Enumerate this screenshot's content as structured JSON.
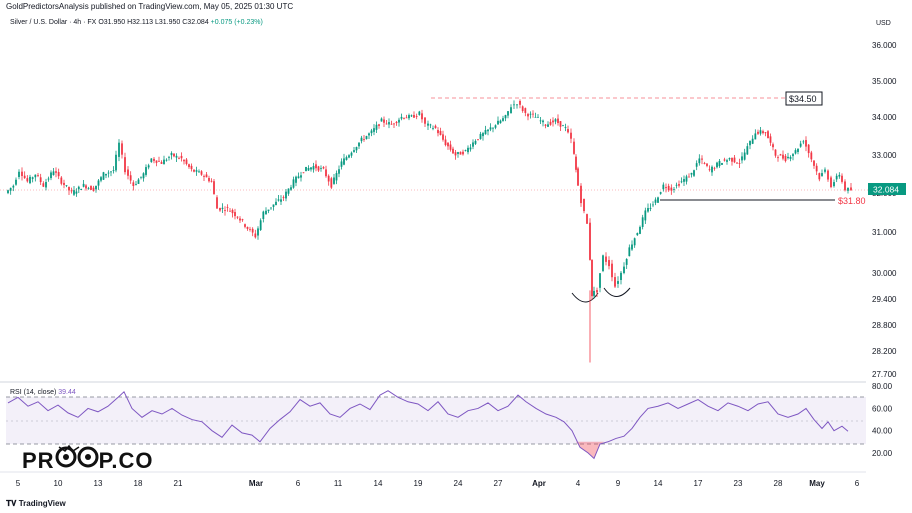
{
  "header": {
    "publisher_line": "GoldPredictorsAnalysis published on TradingView.com, May 05, 2025 01:30 UTC",
    "symbol": "Silver / U.S. Dollar · 4h · FX",
    "ohlc": "O31.950  H32.113  L31.950  C32.084",
    "change": "+0.075 (+0.23%)",
    "currency": "USD"
  },
  "rsi_label": {
    "name": "RSI (14, close)",
    "value": "39.44"
  },
  "footer": {
    "brand": "TradingView"
  },
  "logo": {
    "left": "PR",
    "right": "P.CO"
  },
  "colors": {
    "up": "#089981",
    "down": "#f23645",
    "rsi": "#7e57c2",
    "price_badge": "#089981",
    "resistance": "#f23645"
  },
  "chart_data": [
    {
      "type": "candlestick",
      "title": "Silver / U.S. Dollar · 4h · FX",
      "y_unit": "USD",
      "y_ticks": [
        "36.000",
        "35.000",
        "34.000",
        "33.000",
        "32.000",
        "31.000",
        "30.000",
        "29.400",
        "28.800",
        "28.200",
        "27.700"
      ],
      "x_ticks": [
        "5",
        "10",
        "13",
        "18",
        "21",
        "Mar",
        "6",
        "11",
        "14",
        "19",
        "24",
        "27",
        "Apr",
        "4",
        "9",
        "14",
        "17",
        "23",
        "28",
        "May",
        "6"
      ],
      "last_price": "32.084",
      "annotations": [
        {
          "type": "resistance",
          "label": "$34.50",
          "value": 34.5
        },
        {
          "type": "support",
          "label": "$31.80",
          "value": 31.8
        },
        {
          "type": "shape",
          "label": "double-bottom",
          "value": 29.4
        }
      ],
      "path": [
        [
          0,
          32.0
        ],
        [
          8,
          32.2
        ],
        [
          14,
          32.6
        ],
        [
          22,
          32.3
        ],
        [
          30,
          32.5
        ],
        [
          38,
          32.2
        ],
        [
          48,
          32.6
        ],
        [
          56,
          32.3
        ],
        [
          66,
          32.0
        ],
        [
          78,
          32.2
        ],
        [
          88,
          32.1
        ],
        [
          98,
          32.5
        ],
        [
          108,
          32.6
        ],
        [
          114,
          33.3
        ],
        [
          120,
          32.6
        ],
        [
          128,
          32.2
        ],
        [
          138,
          32.5
        ],
        [
          146,
          32.9
        ],
        [
          156,
          32.8
        ],
        [
          166,
          33.0
        ],
        [
          176,
          32.9
        ],
        [
          186,
          32.6
        ],
        [
          196,
          32.5
        ],
        [
          206,
          32.3
        ],
        [
          212,
          31.6
        ],
        [
          222,
          31.6
        ],
        [
          232,
          31.4
        ],
        [
          242,
          31.1
        ],
        [
          250,
          30.9
        ],
        [
          258,
          31.5
        ],
        [
          268,
          31.7
        ],
        [
          278,
          31.9
        ],
        [
          288,
          32.3
        ],
        [
          298,
          32.6
        ],
        [
          308,
          32.7
        ],
        [
          318,
          32.6
        ],
        [
          326,
          32.2
        ],
        [
          336,
          32.8
        ],
        [
          346,
          33.1
        ],
        [
          356,
          33.4
        ],
        [
          366,
          33.6
        ],
        [
          376,
          33.9
        ],
        [
          386,
          33.8
        ],
        [
          396,
          34.0
        ],
        [
          406,
          34.0
        ],
        [
          414,
          34.1
        ],
        [
          420,
          33.8
        ],
        [
          430,
          33.7
        ],
        [
          440,
          33.3
        ],
        [
          450,
          33.0
        ],
        [
          460,
          33.1
        ],
        [
          470,
          33.4
        ],
        [
          480,
          33.6
        ],
        [
          490,
          33.8
        ],
        [
          500,
          34.0
        ],
        [
          506,
          34.3
        ],
        [
          512,
          34.4
        ],
        [
          520,
          34.1
        ],
        [
          530,
          34.0
        ],
        [
          540,
          33.8
        ],
        [
          550,
          33.9
        ],
        [
          560,
          33.7
        ],
        [
          566,
          33.4
        ],
        [
          570,
          32.6
        ],
        [
          576,
          31.8
        ],
        [
          582,
          31.2
        ],
        [
          586,
          29.5
        ],
        [
          592,
          29.6
        ],
        [
          598,
          30.4
        ],
        [
          604,
          30.2
        ],
        [
          610,
          29.7
        ],
        [
          616,
          30.0
        ],
        [
          624,
          30.6
        ],
        [
          632,
          31.0
        ],
        [
          640,
          31.5
        ],
        [
          650,
          31.8
        ],
        [
          658,
          32.2
        ],
        [
          666,
          32.1
        ],
        [
          676,
          32.3
        ],
        [
          686,
          32.5
        ],
        [
          694,
          32.9
        ],
        [
          704,
          32.6
        ],
        [
          714,
          32.8
        ],
        [
          724,
          32.9
        ],
        [
          734,
          32.8
        ],
        [
          742,
          33.2
        ],
        [
          750,
          33.6
        ],
        [
          760,
          33.6
        ],
        [
          770,
          33.0
        ],
        [
          780,
          32.9
        ],
        [
          790,
          33.1
        ],
        [
          798,
          33.4
        ],
        [
          806,
          32.9
        ],
        [
          814,
          32.4
        ],
        [
          820,
          32.6
        ],
        [
          826,
          32.2
        ],
        [
          834,
          32.5
        ],
        [
          840,
          32.1
        ],
        [
          846,
          32.08
        ]
      ]
    },
    {
      "type": "line",
      "title": "RSI (14, close)",
      "y_ticks": [
        "80.00",
        "60.00",
        "40.00",
        "20.00"
      ],
      "ylim": [
        10,
        82
      ],
      "bands": {
        "upper": 70,
        "middle": 50,
        "lower": 30
      },
      "last_value": 39.44,
      "path": [
        [
          0,
          65
        ],
        [
          10,
          70
        ],
        [
          20,
          62
        ],
        [
          30,
          66
        ],
        [
          40,
          58
        ],
        [
          50,
          63
        ],
        [
          60,
          56
        ],
        [
          70,
          52
        ],
        [
          80,
          60
        ],
        [
          90,
          57
        ],
        [
          100,
          62
        ],
        [
          110,
          70
        ],
        [
          116,
          75
        ],
        [
          124,
          60
        ],
        [
          134,
          52
        ],
        [
          144,
          58
        ],
        [
          154,
          55
        ],
        [
          164,
          60
        ],
        [
          174,
          54
        ],
        [
          184,
          50
        ],
        [
          194,
          48
        ],
        [
          204,
          40
        ],
        [
          214,
          34
        ],
        [
          224,
          45
        ],
        [
          234,
          38
        ],
        [
          244,
          36
        ],
        [
          252,
          30
        ],
        [
          262,
          42
        ],
        [
          272,
          50
        ],
        [
          282,
          57
        ],
        [
          292,
          68
        ],
        [
          302,
          62
        ],
        [
          312,
          65
        ],
        [
          322,
          55
        ],
        [
          332,
          52
        ],
        [
          342,
          60
        ],
        [
          352,
          64
        ],
        [
          362,
          59
        ],
        [
          372,
          72
        ],
        [
          380,
          76
        ],
        [
          390,
          70
        ],
        [
          400,
          66
        ],
        [
          410,
          64
        ],
        [
          420,
          58
        ],
        [
          430,
          66
        ],
        [
          440,
          55
        ],
        [
          450,
          52
        ],
        [
          460,
          58
        ],
        [
          470,
          60
        ],
        [
          480,
          65
        ],
        [
          490,
          58
        ],
        [
          500,
          62
        ],
        [
          510,
          72
        ],
        [
          518,
          66
        ],
        [
          528,
          60
        ],
        [
          538,
          55
        ],
        [
          548,
          52
        ],
        [
          556,
          48
        ],
        [
          564,
          40
        ],
        [
          572,
          25
        ],
        [
          580,
          20
        ],
        [
          586,
          15
        ],
        [
          592,
          28
        ],
        [
          600,
          30
        ],
        [
          608,
          33
        ],
        [
          616,
          35
        ],
        [
          624,
          42
        ],
        [
          632,
          52
        ],
        [
          640,
          60
        ],
        [
          650,
          62
        ],
        [
          660,
          65
        ],
        [
          670,
          60
        ],
        [
          680,
          64
        ],
        [
          690,
          68
        ],
        [
          700,
          62
        ],
        [
          710,
          58
        ],
        [
          720,
          65
        ],
        [
          730,
          62
        ],
        [
          740,
          58
        ],
        [
          750,
          64
        ],
        [
          760,
          66
        ],
        [
          770,
          55
        ],
        [
          780,
          52
        ],
        [
          790,
          55
        ],
        [
          798,
          60
        ],
        [
          806,
          50
        ],
        [
          814,
          42
        ],
        [
          820,
          48
        ],
        [
          826,
          40
        ],
        [
          834,
          44
        ],
        [
          840,
          39.44
        ]
      ]
    }
  ]
}
